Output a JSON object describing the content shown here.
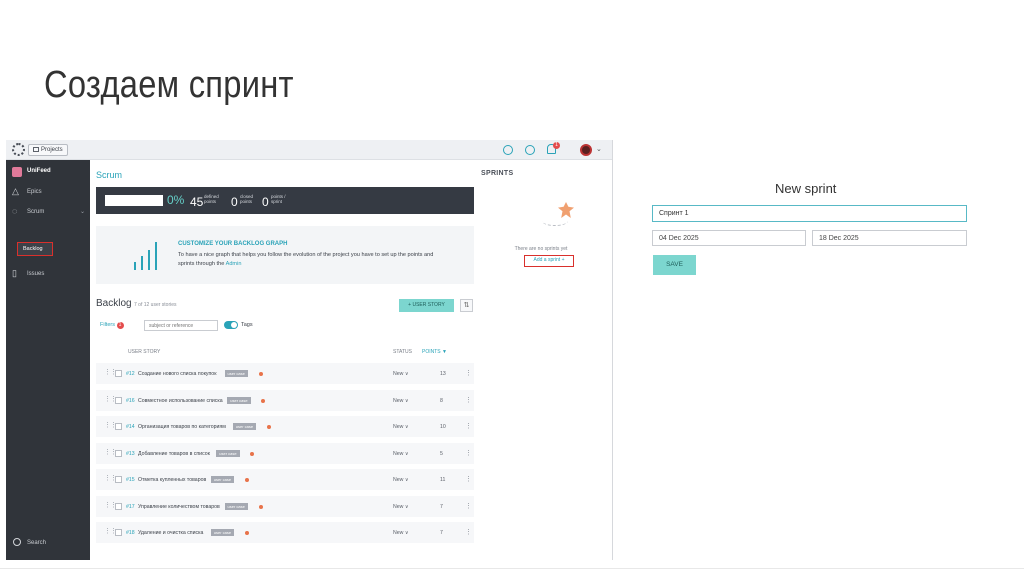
{
  "slide": {
    "title": "Создаем спринт"
  },
  "topbar": {
    "projects_label": "Projects",
    "notification_count": "1"
  },
  "sidebar": {
    "project": "UniFeed",
    "items": [
      {
        "label": "Epics",
        "icon": "epics-icon"
      },
      {
        "label": "Scrum",
        "icon": "scrum-icon"
      },
      {
        "label": "Issues",
        "icon": "issues-icon"
      }
    ],
    "sub_item": "Backlog",
    "search": "Search"
  },
  "scrum": {
    "title": "Scrum",
    "percent": "0%",
    "defined_points": "45",
    "defined_label": "defined points",
    "closed_points": "0",
    "closed_label": "closed points",
    "points_week": "0",
    "points_week_label": "points / sprint"
  },
  "promo": {
    "heading": "CUSTOMIZE YOUR BACKLOG GRAPH",
    "text": "To have a nice graph that helps you follow the evolution of the project you have to set up the points and sprints through the",
    "link": "Admin"
  },
  "sprints": {
    "title": "SPRINTS",
    "empty": "There are no sprints yet",
    "add": "Add a sprint +"
  },
  "backlog": {
    "title": "Backlog",
    "count": "7 of 12 user stories",
    "user_story_btn": "+ USER STORY",
    "filters": "Filters",
    "filters_badge": "1",
    "search_placeholder": "subject or reference",
    "tags": "Tags",
    "columns": {
      "user_story": "USER STORY",
      "status": "STATUS",
      "points": "POINTS ▼"
    },
    "tag_label": "user case",
    "rows": [
      {
        "ref": "#12",
        "name": "Создание нового списка покупок",
        "status": "New ∨",
        "points": "13"
      },
      {
        "ref": "#16",
        "name": "Совместное использование списка",
        "status": "New ∨",
        "points": "8"
      },
      {
        "ref": "#14",
        "name": "Организация товаров по категориям",
        "status": "New ∨",
        "points": "10"
      },
      {
        "ref": "#13",
        "name": "Добавление товаров в список",
        "status": "New ∨",
        "points": "5"
      },
      {
        "ref": "#15",
        "name": "Отметка купленных товаров",
        "status": "New ∨",
        "points": "11"
      },
      {
        "ref": "#17",
        "name": "Управление количеством товаров",
        "status": "New ∨",
        "points": "7"
      },
      {
        "ref": "#18",
        "name": "Удаление и очистка списка",
        "status": "New ∨",
        "points": "7"
      }
    ]
  },
  "new_sprint": {
    "title": "New sprint",
    "name_value": "Спринт 1",
    "start_date": "04 Dec 2025",
    "end_date": "18 Dec 2025",
    "save": "SAVE"
  },
  "colors": {
    "accent": "#2aa3b8",
    "sidebar": "#30343a",
    "stats_bar": "#353a43",
    "highlight": "#d9302c",
    "button": "#7cd6cf"
  }
}
